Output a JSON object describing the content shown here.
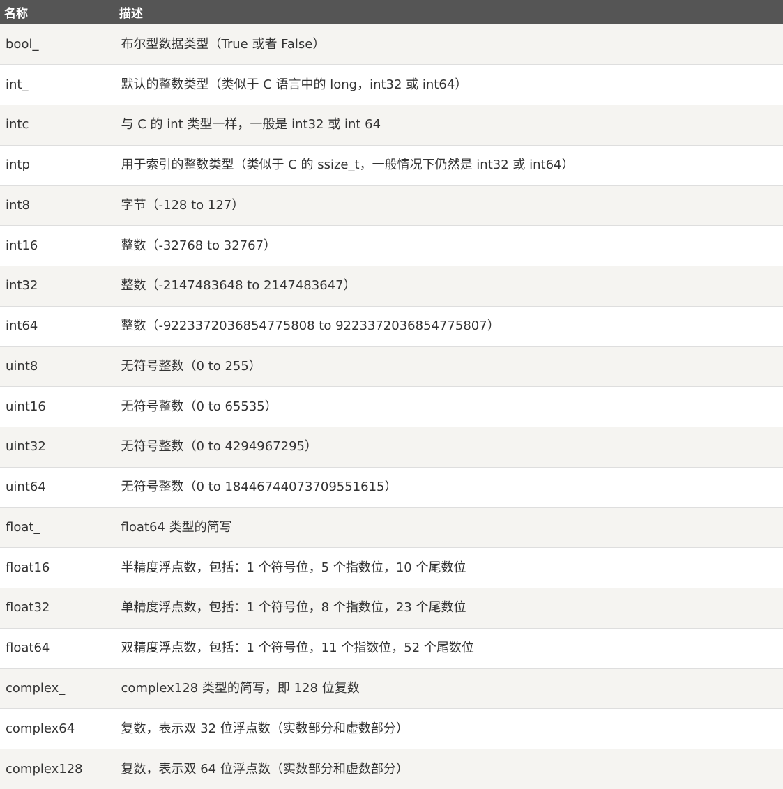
{
  "table": {
    "headers": [
      "名称",
      "描述"
    ],
    "rows": [
      {
        "name": "bool_",
        "desc": "布尔型数据类型（True 或者 False）"
      },
      {
        "name": "int_",
        "desc": "默认的整数类型（类似于 C 语言中的 long，int32 或 int64）"
      },
      {
        "name": "intc",
        "desc": "与 C 的 int 类型一样，一般是 int32 或 int 64"
      },
      {
        "name": "intp",
        "desc": "用于索引的整数类型（类似于 C 的 ssize_t，一般情况下仍然是 int32 或 int64）"
      },
      {
        "name": "int8",
        "desc": "字节（-128 to 127）"
      },
      {
        "name": "int16",
        "desc": "整数（-32768 to 32767）"
      },
      {
        "name": "int32",
        "desc": "整数（-2147483648 to 2147483647）"
      },
      {
        "name": "int64",
        "desc": "整数（-9223372036854775808 to 9223372036854775807）"
      },
      {
        "name": "uint8",
        "desc": "无符号整数（0 to 255）"
      },
      {
        "name": "uint16",
        "desc": "无符号整数（0 to 65535）"
      },
      {
        "name": "uint32",
        "desc": "无符号整数（0 to 4294967295）"
      },
      {
        "name": "uint64",
        "desc": "无符号整数（0 to 18446744073709551615）"
      },
      {
        "name": "float_",
        "desc": "float64 类型的简写"
      },
      {
        "name": "float16",
        "desc": "半精度浮点数，包括：1 个符号位，5 个指数位，10 个尾数位"
      },
      {
        "name": "float32",
        "desc": "单精度浮点数，包括：1 个符号位，8 个指数位，23 个尾数位"
      },
      {
        "name": "float64",
        "desc": "双精度浮点数，包括：1 个符号位，11 个指数位，52 个尾数位"
      },
      {
        "name": "complex_",
        "desc": "complex128 类型的简写，即 128 位复数"
      },
      {
        "name": "complex64",
        "desc": "复数，表示双 32 位浮点数（实数部分和虚数部分）"
      },
      {
        "name": "complex128",
        "desc": "复数，表示双 64 位浮点数（实数部分和虚数部分）"
      }
    ]
  },
  "colors": {
    "header_bg": "#555555",
    "header_text": "#ffffff",
    "row_odd_bg": "#f5f4f1",
    "row_even_bg": "#ffffff",
    "text": "#333333"
  }
}
